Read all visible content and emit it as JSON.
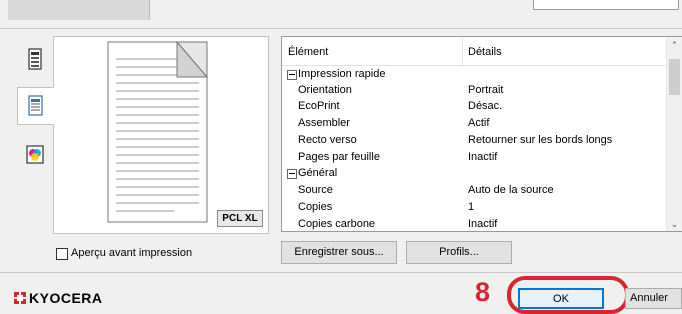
{
  "sidebar": {
    "tabs": [
      {
        "icon": "printer-settings-icon",
        "selected": false
      },
      {
        "icon": "document-page-icon",
        "selected": true
      },
      {
        "icon": "color-print-icon",
        "selected": false
      }
    ]
  },
  "preview": {
    "badge": "PCL XL",
    "checkbox_label": "Aperçu avant impression",
    "checkbox_checked": false
  },
  "table": {
    "col_element": "Élément",
    "col_details": "Détails",
    "rows": [
      {
        "element": "Impression rapide",
        "details": "",
        "group": true
      },
      {
        "element": "Orientation",
        "details": "Portrait",
        "group": false
      },
      {
        "element": "EcoPrint",
        "details": "Désac.",
        "group": false
      },
      {
        "element": "Assembler",
        "details": "Actif",
        "group": false
      },
      {
        "element": "Recto verso",
        "details": "Retourner sur les bords longs",
        "group": false
      },
      {
        "element": "Pages par feuille",
        "details": "Inactif",
        "group": false
      },
      {
        "element": "Général",
        "details": "",
        "group": true
      },
      {
        "element": "Source",
        "details": "Auto de la source",
        "group": false
      },
      {
        "element": "Copies",
        "details": "1",
        "group": false
      },
      {
        "element": "Copies carbone",
        "details": "Inactif",
        "group": false
      }
    ]
  },
  "buttons": {
    "save_as": "Enregistrer sous...",
    "profiles": "Profils...",
    "ok": "OK",
    "cancel": "Annuler"
  },
  "brand": {
    "logo_text": "KYOCERA",
    "accent": "#d7262c"
  },
  "annotation": {
    "step": "8"
  }
}
